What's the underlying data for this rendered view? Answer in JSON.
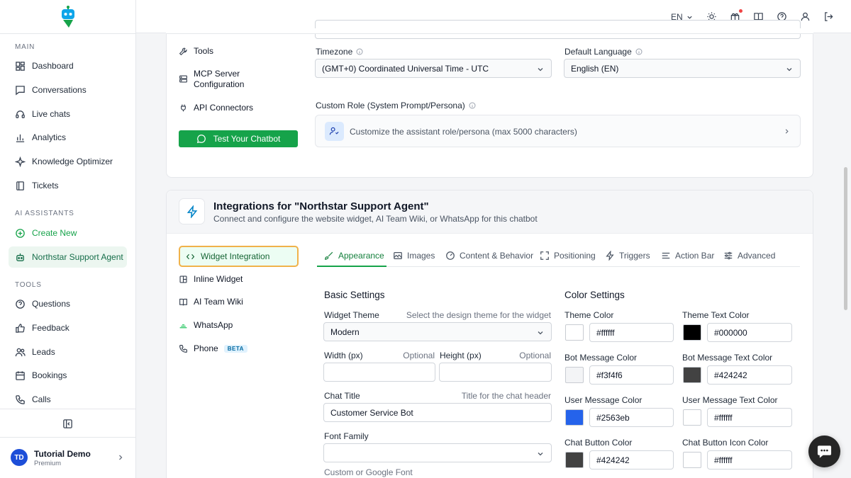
{
  "sidebar": {
    "sections": {
      "main": "MAIN",
      "ai": "AI ASSISTANTS",
      "tools": "TOOLS"
    },
    "main_items": [
      "Dashboard",
      "Conversations",
      "Live chats",
      "Analytics",
      "Knowledge Optimizer",
      "Tickets"
    ],
    "ai_items": [
      "Create New",
      "Northstar Support Agent"
    ],
    "tools_items": [
      "Questions",
      "Feedback",
      "Leads",
      "Bookings",
      "Calls"
    ],
    "user": {
      "initials": "TD",
      "name": "Tutorial Demo",
      "plan": "Premium"
    }
  },
  "header": {
    "language": "EN"
  },
  "settings": {
    "menu": [
      "Tools",
      "MCP Server",
      "Configuration",
      "API Connectors"
    ],
    "test_button": "Test Your Chatbot",
    "timezone_label": "Timezone",
    "timezone_value": "(GMT+0) Coordinated Universal Time - UTC",
    "language_label": "Default Language",
    "language_value": "English (EN)",
    "role_label": "Custom Role (System Prompt/Persona)",
    "role_placeholder": "Customize the assistant role/persona (max 5000 characters)"
  },
  "integrations": {
    "title": "Integrations for \"Northstar Support Agent\"",
    "subtitle": "Connect and configure the website widget, AI Team Wiki, or WhatsApp for this chatbot",
    "menu": [
      "Widget Integration",
      "Inline Widget",
      "AI Team Wiki",
      "WhatsApp",
      "Phone"
    ],
    "beta": "BETA",
    "tabs": [
      "Appearance",
      "Images",
      "Content & Behavior",
      "Positioning",
      "Triggers",
      "Action Bar",
      "Advanced"
    ],
    "basic": {
      "heading": "Basic Settings",
      "theme_label": "Widget Theme",
      "theme_hint": "Select the design theme for the widget",
      "theme_value": "Modern",
      "width_label": "Width (px)",
      "height_label": "Height (px)",
      "optional": "Optional",
      "title_label": "Chat Title",
      "title_hint": "Title for the chat header",
      "title_value": "Customer Service Bot",
      "font_label": "Font Family",
      "font_hint": "Custom or Google Font"
    },
    "colors": {
      "heading": "Color Settings",
      "items": [
        {
          "label": "Theme Color",
          "value": "#ffffff"
        },
        {
          "label": "Theme Text Color",
          "value": "#000000"
        },
        {
          "label": "Bot Message Color",
          "value": "#f3f4f6"
        },
        {
          "label": "Bot Message Text Color",
          "value": "#424242"
        },
        {
          "label": "User Message Color",
          "value": "#2563eb"
        },
        {
          "label": "User Message Text Color",
          "value": "#ffffff"
        },
        {
          "label": "Chat Button Color",
          "value": "#424242"
        },
        {
          "label": "Chat Button Icon Color",
          "value": "#ffffff"
        }
      ]
    }
  }
}
